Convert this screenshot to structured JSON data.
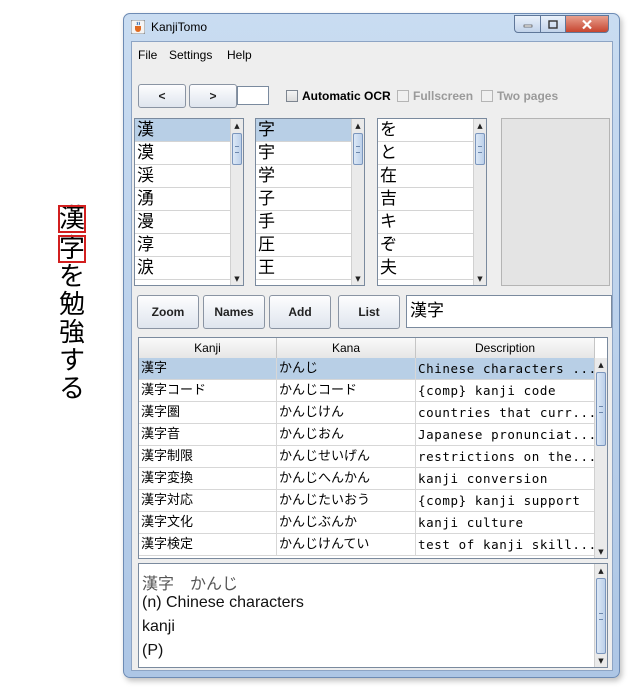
{
  "sample_text": {
    "boxed": [
      "漢",
      "字"
    ],
    "rest": [
      "を",
      "勉",
      "強",
      "す",
      "る"
    ]
  },
  "window": {
    "title": "KanjiTomo",
    "icon": "java-cup-icon",
    "controls": {
      "minimize_icon": "minimize-icon",
      "maximize_icon": "maximize-icon",
      "close_icon": "close-icon"
    }
  },
  "menu": [
    "File",
    "Settings",
    "Help"
  ],
  "toolbar": {
    "prev_label": "<",
    "next_label": ">",
    "page_value": "",
    "automatic_ocr": "Automatic OCR",
    "fullscreen": "Fullscreen",
    "two_pages": "Two pages"
  },
  "candidates": {
    "column1": [
      "漢",
      "漠",
      "渓",
      "湧",
      "漫",
      "淳",
      "涙"
    ],
    "column2": [
      "字",
      "宇",
      "学",
      "子",
      "手",
      "圧",
      "王"
    ],
    "column3": [
      "を",
      "と",
      "在",
      "吉",
      "キ",
      "ぞ",
      "夫"
    ]
  },
  "actions": {
    "zoom": "Zoom",
    "names": "Names",
    "add": "Add",
    "list": "List",
    "word_value": "漢字"
  },
  "results": {
    "headers": [
      "Kanji",
      "Kana",
      "Description"
    ],
    "rows": [
      [
        "漢字",
        "かんじ",
        "Chinese characters ..."
      ],
      [
        "漢字コード",
        "かんじコード",
        "{comp} kanji code"
      ],
      [
        "漢字圏",
        "かんじけん",
        "countries that curr..."
      ],
      [
        "漢字音",
        "かんじおん",
        "Japanese pronunciat..."
      ],
      [
        "漢字制限",
        "かんじせいげん",
        "restrictions on the..."
      ],
      [
        "漢字変換",
        "かんじへんかん",
        "kanji conversion"
      ],
      [
        "漢字対応",
        "かんじたいおう",
        "{comp} kanji support"
      ],
      [
        "漢字文化",
        "かんじぶんか",
        "kanji culture"
      ],
      [
        "漢字検定",
        "かんじけんてい",
        "test of kanji skill..."
      ]
    ]
  },
  "details": {
    "line1": "漢字　かんじ",
    "line2": "(n) Chinese characters",
    "line3": "kanji",
    "line4": "(P)"
  },
  "colors": {
    "selection": "#b8cfe6",
    "accent_box": "#d21f1f",
    "title_gradient_top": "#c9dcf1"
  }
}
